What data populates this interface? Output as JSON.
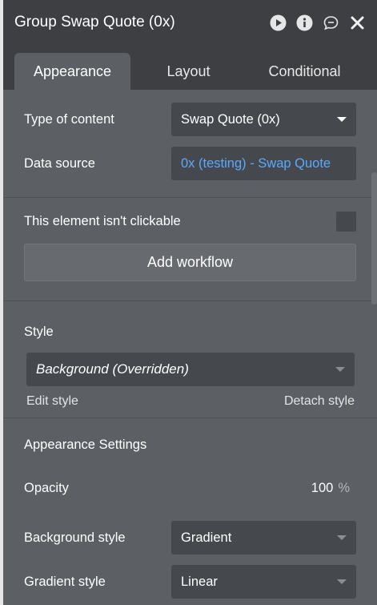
{
  "window": {
    "title": "Group Swap Quote (0x)",
    "icons": [
      "play-icon",
      "info-icon",
      "comment-icon",
      "close-icon"
    ]
  },
  "tabs": [
    {
      "label": "Appearance",
      "active": true
    },
    {
      "label": "Layout",
      "active": false
    },
    {
      "label": "Conditional",
      "active": false
    }
  ],
  "content": {
    "type_of_content_label": "Type of content",
    "type_of_content_value": "Swap Quote (0x)",
    "data_source_label": "Data source",
    "data_source_value": "0x (testing) - Swap Quote"
  },
  "clickable": {
    "label": "This element isn't clickable",
    "checked": false,
    "add_workflow_label": "Add workflow"
  },
  "style": {
    "heading": "Style",
    "value": "Background (Overridden)",
    "edit_label": "Edit style",
    "detach_label": "Detach style"
  },
  "appearance_settings": {
    "heading": "Appearance Settings",
    "opacity_label": "Opacity",
    "opacity_value": "100",
    "opacity_unit": "%",
    "background_style_label": "Background style",
    "background_style_value": "Gradient",
    "gradient_style_label": "Gradient style",
    "gradient_style_value": "Linear"
  },
  "colors": {
    "panel_bg": "#5c5f63",
    "header_bg": "#3d3f42",
    "input_bg": "#45484c",
    "link_blue": "#5aa9ff"
  }
}
